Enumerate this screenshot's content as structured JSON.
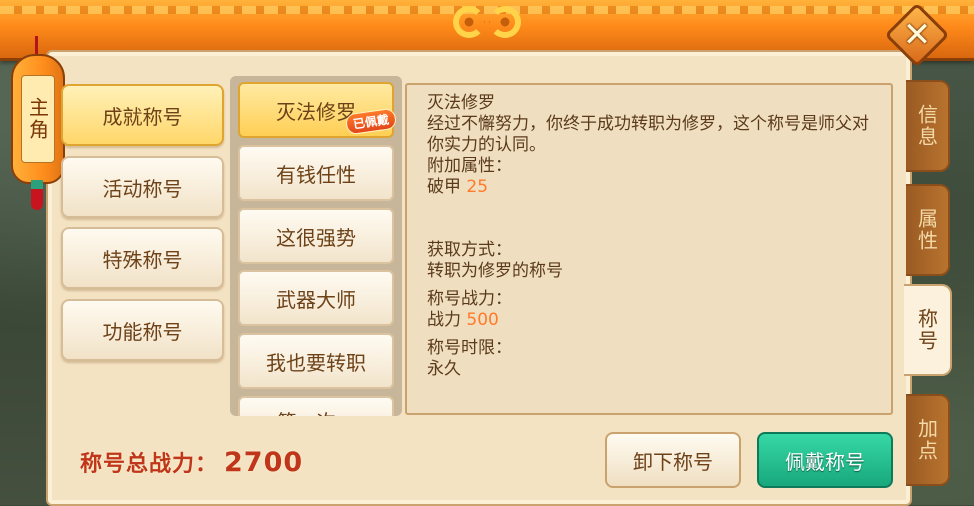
{
  "header": {
    "close_label": "✕"
  },
  "side_tag": {
    "label": "主角"
  },
  "categories": [
    {
      "label": "成就称号",
      "active": true
    },
    {
      "label": "活动称号"
    },
    {
      "label": "特殊称号"
    },
    {
      "label": "功能称号"
    }
  ],
  "titles": [
    {
      "label": "灭法修罗",
      "active": true,
      "badge": "已佩戴"
    },
    {
      "label": "有钱任性"
    },
    {
      "label": "这很强势"
    },
    {
      "label": "武器大师"
    },
    {
      "label": "我也要转职"
    },
    {
      "label": "第一次..."
    }
  ],
  "detail": {
    "name": "灭法修罗",
    "description": "经过不懈努力，你终于成功转职为修罗，这个称号是师父对你实力的认同。",
    "attr_label": "附加属性：",
    "attr_name": "破甲",
    "attr_value": "25",
    "obtain_label": "获取方式：",
    "obtain_value": "转职为修罗的称号",
    "power_label": "称号战力：",
    "power_name": "战力",
    "power_value": "500",
    "time_label": "称号时限：",
    "time_value": "永久"
  },
  "footer": {
    "total_label": "称号总战力：",
    "total_value": "2700",
    "unequip_label": "卸下称号",
    "equip_label": "佩戴称号"
  },
  "right_tabs": [
    {
      "label": "信息"
    },
    {
      "label": "属性"
    },
    {
      "label": "称号",
      "active": true
    },
    {
      "label": "加点"
    }
  ],
  "colors": {
    "accent_orange": "#ff8a1a",
    "equip_green": "#17a87c",
    "number_orange": "#ff7a2a"
  }
}
